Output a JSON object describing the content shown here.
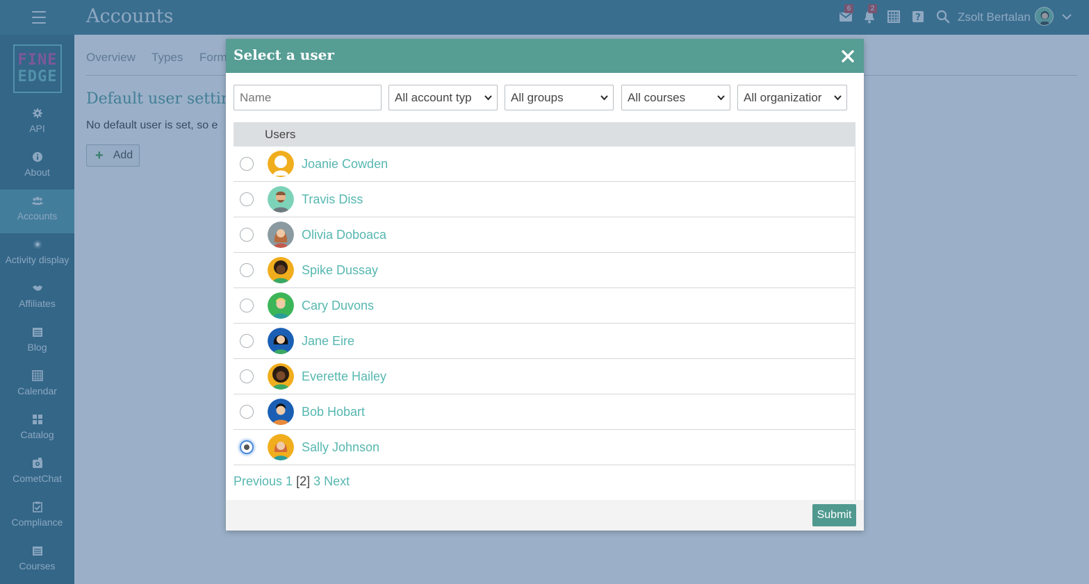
{
  "header": {
    "title": "Accounts",
    "mail_badge": "6",
    "notifications_badge": "2",
    "user_name": "Zsolt Bertalan",
    "icons": [
      "menu-icon",
      "mail-icon",
      "bell-icon",
      "calendar-icon",
      "help-icon",
      "search-icon",
      "chevron-down-icon"
    ]
  },
  "logo": {
    "line1": "FINE",
    "line2": "EDGE"
  },
  "sidebar": {
    "items": [
      {
        "label": "API",
        "icon": "gear-icon"
      },
      {
        "label": "About",
        "icon": "info-icon"
      },
      {
        "label": "Accounts",
        "icon": "users-icon",
        "active": true
      },
      {
        "label": "Activity display",
        "icon": "dot-icon"
      },
      {
        "label": "Affiliates",
        "icon": "handshake-icon"
      },
      {
        "label": "Blog",
        "icon": "newspaper-icon"
      },
      {
        "label": "Calendar",
        "icon": "calendar-icon"
      },
      {
        "label": "Catalog",
        "icon": "grid-icon"
      },
      {
        "label": "CometChat",
        "icon": "chat-icon"
      },
      {
        "label": "Compliance",
        "icon": "checklist-icon"
      },
      {
        "label": "Courses",
        "icon": "courses-icon"
      }
    ]
  },
  "page": {
    "tabs": [
      "Overview",
      "Types",
      "Form"
    ],
    "section_title": "Default user settin",
    "section_text": "No default user is set, so e",
    "add_label": "Add"
  },
  "modal": {
    "title": "Select a user",
    "name_placeholder": "Name",
    "filters": {
      "account_type": "All account typ",
      "groups": "All groups",
      "courses": "All courses",
      "organizations": "All organizatior"
    },
    "column_header": "Users",
    "users": [
      {
        "name": "Joanie Cowden",
        "selected": false
      },
      {
        "name": "Travis Diss",
        "selected": false
      },
      {
        "name": "Olivia Doboaca",
        "selected": false
      },
      {
        "name": "Spike Dussay",
        "selected": false
      },
      {
        "name": "Cary Duvons",
        "selected": false
      },
      {
        "name": "Jane Eire",
        "selected": false
      },
      {
        "name": "Everette Hailey",
        "selected": false
      },
      {
        "name": "Bob Hobart",
        "selected": false
      },
      {
        "name": "Sally Johnson",
        "selected": true
      }
    ],
    "pager": {
      "previous": "Previous",
      "page1": "1",
      "current": "[2]",
      "page3": "3",
      "next": "Next"
    },
    "submit_label": "Submit"
  },
  "colors": {
    "header_bg": "#3c7b8c",
    "sidebar_bg": "#2f6a7d",
    "sidebar_active": "#4e98a7",
    "modal_header": "#569d94",
    "link": "#56b7b0",
    "submit": "#4f998f"
  }
}
